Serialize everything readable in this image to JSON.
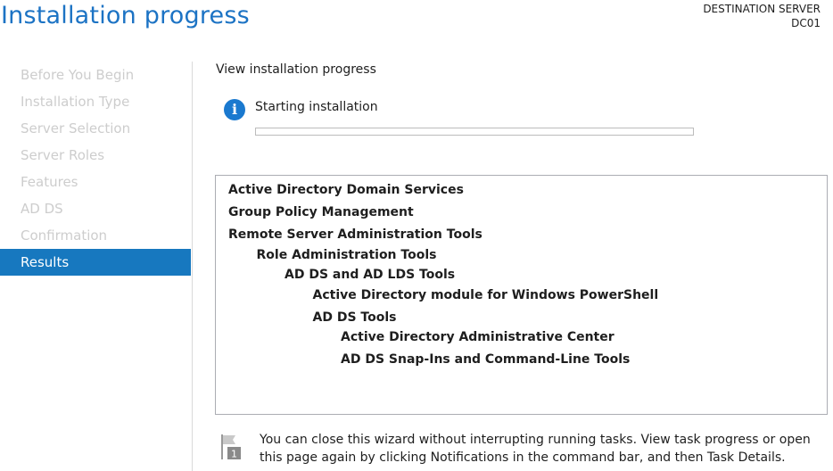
{
  "header": {
    "title": "Installation progress",
    "destination_label": "DESTINATION SERVER",
    "server_name": "DC01"
  },
  "sidebar": {
    "items": [
      {
        "label": "Before You Begin",
        "state": "disabled"
      },
      {
        "label": "Installation Type",
        "state": "disabled"
      },
      {
        "label": "Server Selection",
        "state": "disabled"
      },
      {
        "label": "Server Roles",
        "state": "disabled"
      },
      {
        "label": "Features",
        "state": "disabled"
      },
      {
        "label": "AD DS",
        "state": "disabled"
      },
      {
        "label": "Confirmation",
        "state": "disabled"
      },
      {
        "label": "Results",
        "state": "active"
      }
    ]
  },
  "main": {
    "section_title": "View installation progress",
    "status": {
      "icon": "info-icon",
      "text": "Starting installation",
      "progress_percent": 0
    },
    "features": [
      {
        "label": "Active Directory Domain Services",
        "level": 0
      },
      {
        "label": "Group Policy Management",
        "level": 0
      },
      {
        "label": "Remote Server Administration Tools",
        "level": 0
      },
      {
        "label": "Role Administration Tools",
        "level": 1
      },
      {
        "label": "AD DS and AD LDS Tools",
        "level": 2
      },
      {
        "label": "Active Directory module for Windows PowerShell",
        "level": 3
      },
      {
        "label": "AD DS Tools",
        "level": 3
      },
      {
        "label": "Active Directory Administrative Center",
        "level": 4
      },
      {
        "label": "AD DS Snap-Ins and Command-Line Tools",
        "level": 4
      }
    ],
    "note": {
      "icon": "flag-icon",
      "badge": "1",
      "text": "You can close this wizard without interrupting running tasks. View task progress or open this page again by clicking Notifications in the command bar, and then Task Details."
    }
  },
  "colors": {
    "title": "#1c73c4",
    "active_nav": "#1778bf",
    "inactive_nav_text": "#cdcdcd",
    "info_icon": "#1a79cf"
  }
}
